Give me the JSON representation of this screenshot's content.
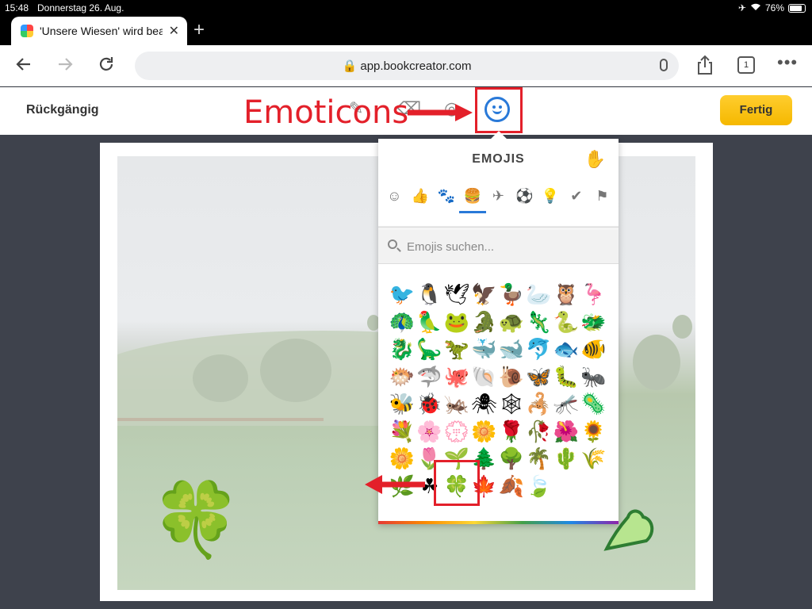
{
  "status": {
    "time": "15:48",
    "date": "Donnerstag 26. Aug.",
    "battery": "76%",
    "battery_level": 0.76
  },
  "browser": {
    "tab_title": "'Unsere Wiesen' wird bearbeitet",
    "url": "app.bookcreator.com",
    "tab_count": "1"
  },
  "app": {
    "undo_label": "Rückgängig",
    "done_label": "Fertig",
    "annotation_label": "Emoticons"
  },
  "emoji_panel": {
    "title": "EMOJIS",
    "skin_tone_icon": "✋",
    "search_placeholder": "Emojis suchen...",
    "categories": [
      {
        "name": "smileys",
        "glyph": "☺"
      },
      {
        "name": "people",
        "glyph": "👍"
      },
      {
        "name": "animals",
        "glyph": "🐾"
      },
      {
        "name": "food",
        "glyph": "🍔"
      },
      {
        "name": "travel",
        "glyph": "✈"
      },
      {
        "name": "activity",
        "glyph": "⚽"
      },
      {
        "name": "objects",
        "glyph": "💡"
      },
      {
        "name": "symbols",
        "glyph": "✔"
      },
      {
        "name": "flags",
        "glyph": "⚑"
      }
    ],
    "active_category": 3,
    "rows": [
      [
        "🐦",
        "🐧",
        "🕊",
        "🦅",
        "🦆",
        "🦢",
        "🦉",
        "🦩"
      ],
      [
        "🦚",
        "🦜",
        "🐸",
        "🐊",
        "🐢",
        "🦎",
        "🐍",
        "🐲"
      ],
      [
        "🐉",
        "🦕",
        "🦖",
        "🐳",
        "🐋",
        "🐬",
        "🐟",
        "🐠"
      ],
      [
        "🐡",
        "🦈",
        "🐙",
        "🐚",
        "🐌",
        "🦋",
        "🐛",
        "🐜"
      ],
      [
        "🐝",
        "🐞",
        "🦗",
        "🕷",
        "🕸",
        "🦂",
        "🦟",
        "🦠"
      ],
      [
        "💐",
        "🌸",
        "💮",
        "🌼",
        "🌹",
        "🥀",
        "🌺",
        "🌻"
      ],
      [
        "🌼",
        "🌷",
        "🌱",
        "🌲",
        "🌳",
        "🌴",
        "🌵",
        "🌾"
      ],
      [
        "🌿",
        "☘",
        "🍀",
        "🍁",
        "🍂",
        "🍃"
      ]
    ]
  },
  "canvas": {
    "clover": "🍀"
  }
}
